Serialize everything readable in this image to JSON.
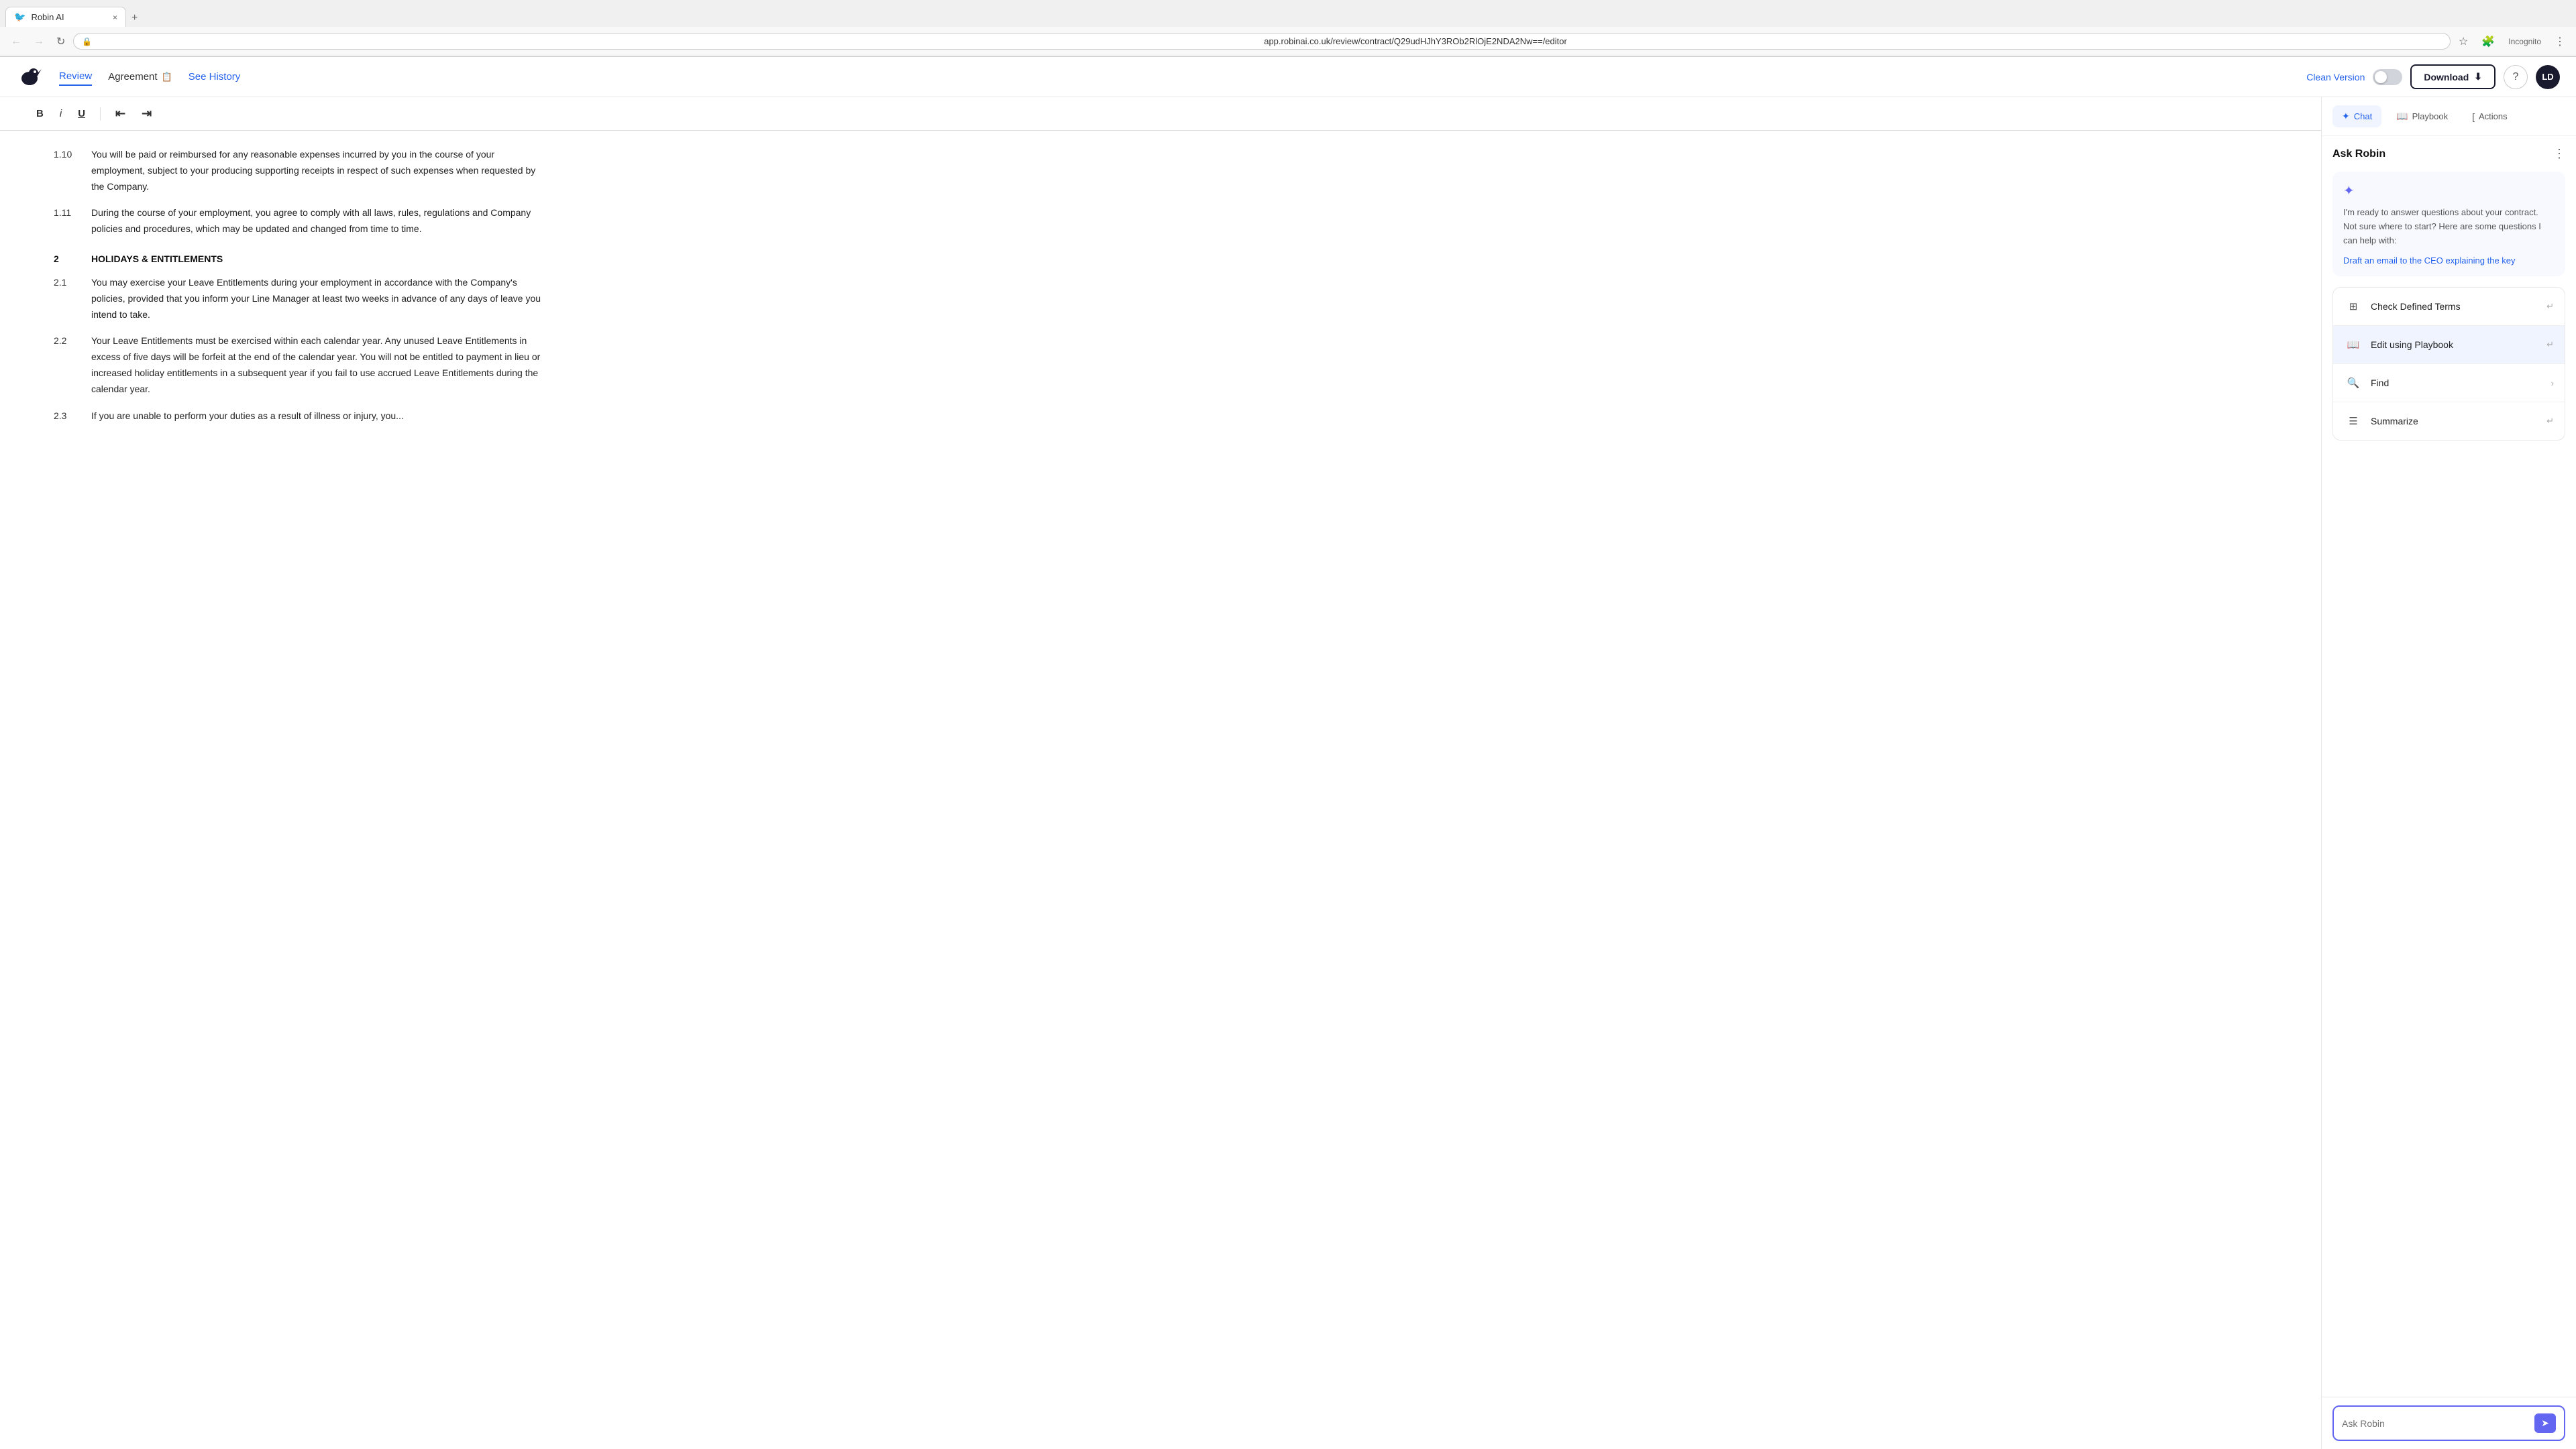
{
  "browser": {
    "tab_label": "Robin AI",
    "tab_close": "×",
    "new_tab": "+",
    "url": "app.robinai.co.uk/review/contract/Q29udHJhY3ROb2RlOjE2NDA2Nw==/editor",
    "nav_back": "←",
    "nav_forward": "→",
    "nav_refresh": "↻",
    "nav_incognito": "Incognito"
  },
  "header": {
    "nav_review": "Review",
    "doc_name": "Agreement",
    "see_history": "See History",
    "clean_version": "Clean Version",
    "download": "Download",
    "avatar": "LD"
  },
  "toolbar": {
    "bold": "B",
    "italic": "i",
    "underline": "U",
    "indent_left": "⇤",
    "indent_right": "⇥"
  },
  "document": {
    "clauses": [
      {
        "num": "1.10",
        "text": "You will be paid or reimbursed for any reasonable expenses incurred by you in the course of your employment, subject to your producing supporting receipts in respect of such expenses when requested by the Company."
      },
      {
        "num": "1.11",
        "text": "During the course of your employment, you agree to comply with all laws, rules, regulations and Company policies and procedures, which may be updated and changed from time to time."
      }
    ],
    "section2_num": "2",
    "section2_title": "HOLIDAYS & ENTITLEMENTS",
    "clauses2": [
      {
        "num": "2.1",
        "text": "You may exercise your Leave Entitlements during your employment in accordance with the Company's policies, provided that you inform your Line Manager at least two weeks in advance of any days of leave you intend to take."
      },
      {
        "num": "2.2",
        "text": "Your Leave Entitlements must be exercised within each calendar year. Any unused Leave Entitlements in excess of five days will be forfeit at the end of the calendar year. You will not be entitled to payment in lieu or increased holiday entitlements in a subsequent year if you fail to use accrued Leave Entitlements during the calendar year."
      },
      {
        "num": "2.3",
        "text": "If you are unable to perform your duties as a result of illness or injury, you..."
      }
    ]
  },
  "panel": {
    "tab_chat": "Chat",
    "tab_playbook": "Playbook",
    "tab_actions": "Actions",
    "ask_robin_title": "Ask Robin",
    "intro_text": "I'm ready to answer questions about your contract.\nNot sure where to start? Here are some questions I can help with:",
    "suggestion_link": "Draft an email to the CEO explaining the key",
    "actions": [
      {
        "id": "check-defined-terms",
        "label": "Check Defined Terms",
        "icon": "⊞",
        "shortcut": "↵",
        "hovered": false
      },
      {
        "id": "edit-using-playbook",
        "label": "Edit using Playbook",
        "icon": "📖",
        "shortcut": "↵",
        "hovered": true
      },
      {
        "id": "find",
        "label": "Find",
        "icon": "🔍",
        "shortcut": "›",
        "hovered": false
      },
      {
        "id": "summarize",
        "label": "Summarize",
        "icon": "☰",
        "shortcut": "↵",
        "hovered": false
      }
    ],
    "input_placeholder": "Ask Robin"
  }
}
